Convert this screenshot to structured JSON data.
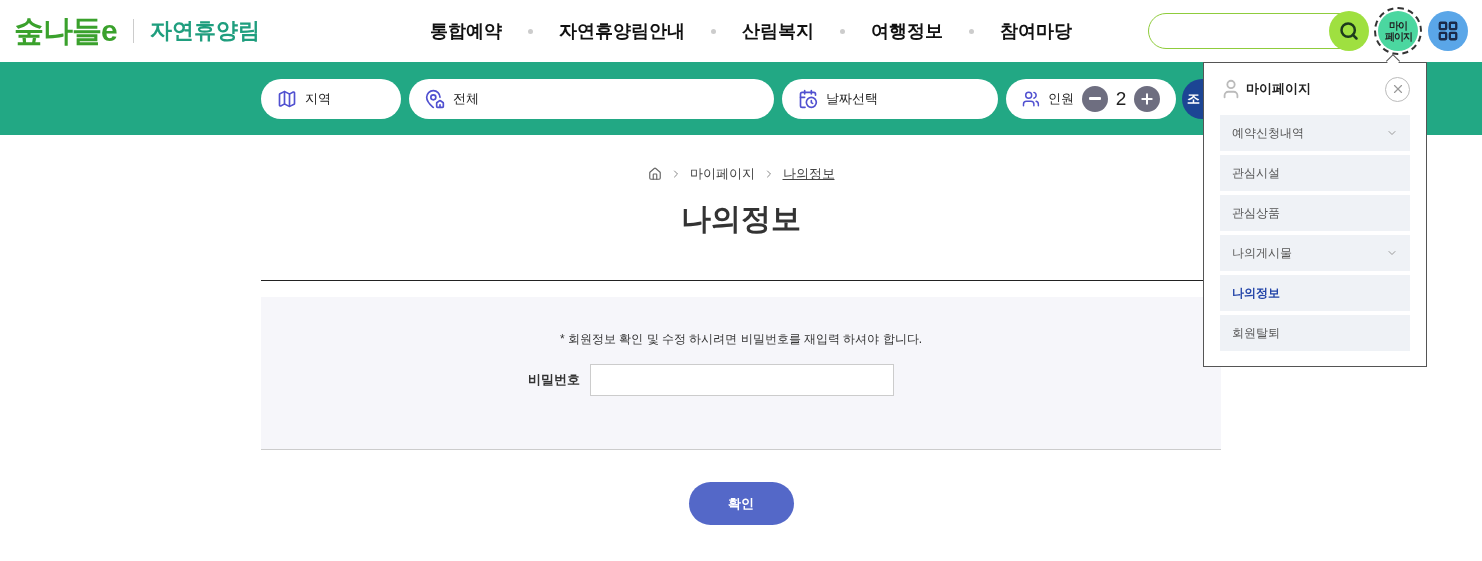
{
  "header": {
    "logo": "숲나들e",
    "site_name": "자연휴양림",
    "nav": [
      {
        "label": "통합예약"
      },
      {
        "label": "자연휴양림안내"
      },
      {
        "label": "산림복지"
      },
      {
        "label": "여행정보"
      },
      {
        "label": "참여마당"
      }
    ],
    "mypage_button": {
      "label": "마이\n페이지",
      "focused": true
    }
  },
  "search_bar": {
    "region": "지역",
    "place": "전체",
    "date": "날짜선택",
    "people_label": "인원",
    "people_count": "2",
    "search_button": "조"
  },
  "mypage_menu": {
    "title": "마이페이지",
    "items": [
      {
        "label": "예약신청내역",
        "expandable": true,
        "selected": false
      },
      {
        "label": "관심시설",
        "expandable": false,
        "selected": false
      },
      {
        "label": "관심상품",
        "expandable": false,
        "selected": false
      },
      {
        "label": "나의게시물",
        "expandable": true,
        "selected": false
      },
      {
        "label": "나의정보",
        "expandable": false,
        "selected": true
      },
      {
        "label": "회원탈퇴",
        "expandable": false,
        "selected": false
      }
    ]
  },
  "breadcrumb": [
    {
      "label": "마이페이지",
      "current": false
    },
    {
      "label": "나의정보",
      "current": true
    }
  ],
  "page_title": "나의정보",
  "form": {
    "notice": "* 회원정보 확인 및 수정 하시려면 비밀번호를 재입력 하셔야 합니다.",
    "password_label": "비밀번호",
    "confirm_button": "확인"
  }
}
